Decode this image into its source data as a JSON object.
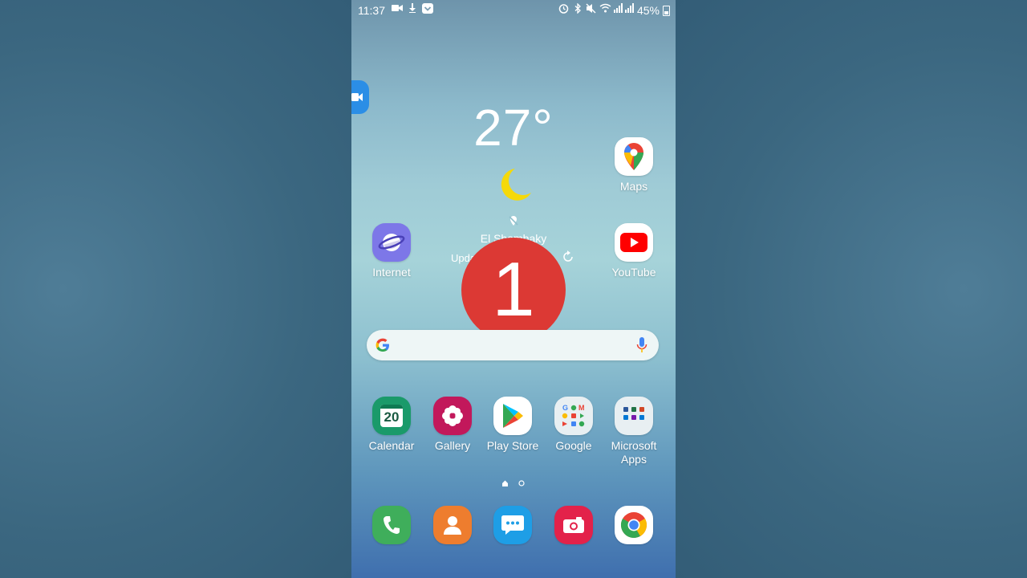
{
  "status_bar": {
    "time": "11:37",
    "battery": "45%"
  },
  "weather": {
    "temperature": "27°",
    "location": "El Shambaky",
    "updated": "Upda"
  },
  "overlay": {
    "badge_number": "1"
  },
  "apps": {
    "maps": "Maps",
    "internet": "Internet",
    "youtube": "YouTube",
    "calendar": "Calendar",
    "calendar_day": "20",
    "gallery": "Gallery",
    "play_store": "Play Store",
    "google": "Google",
    "microsoft_apps": "Microsoft\nApps"
  },
  "colors": {
    "badge": "#dc3934",
    "internet": "#7d77e8",
    "youtube": "#ff0000",
    "calendar": "#1a9a6a",
    "gallery": "#c2185b",
    "phone": "#3fae5b",
    "contacts": "#ee7d2e",
    "messages": "#1e9ee6",
    "camera": "#e3224a"
  }
}
